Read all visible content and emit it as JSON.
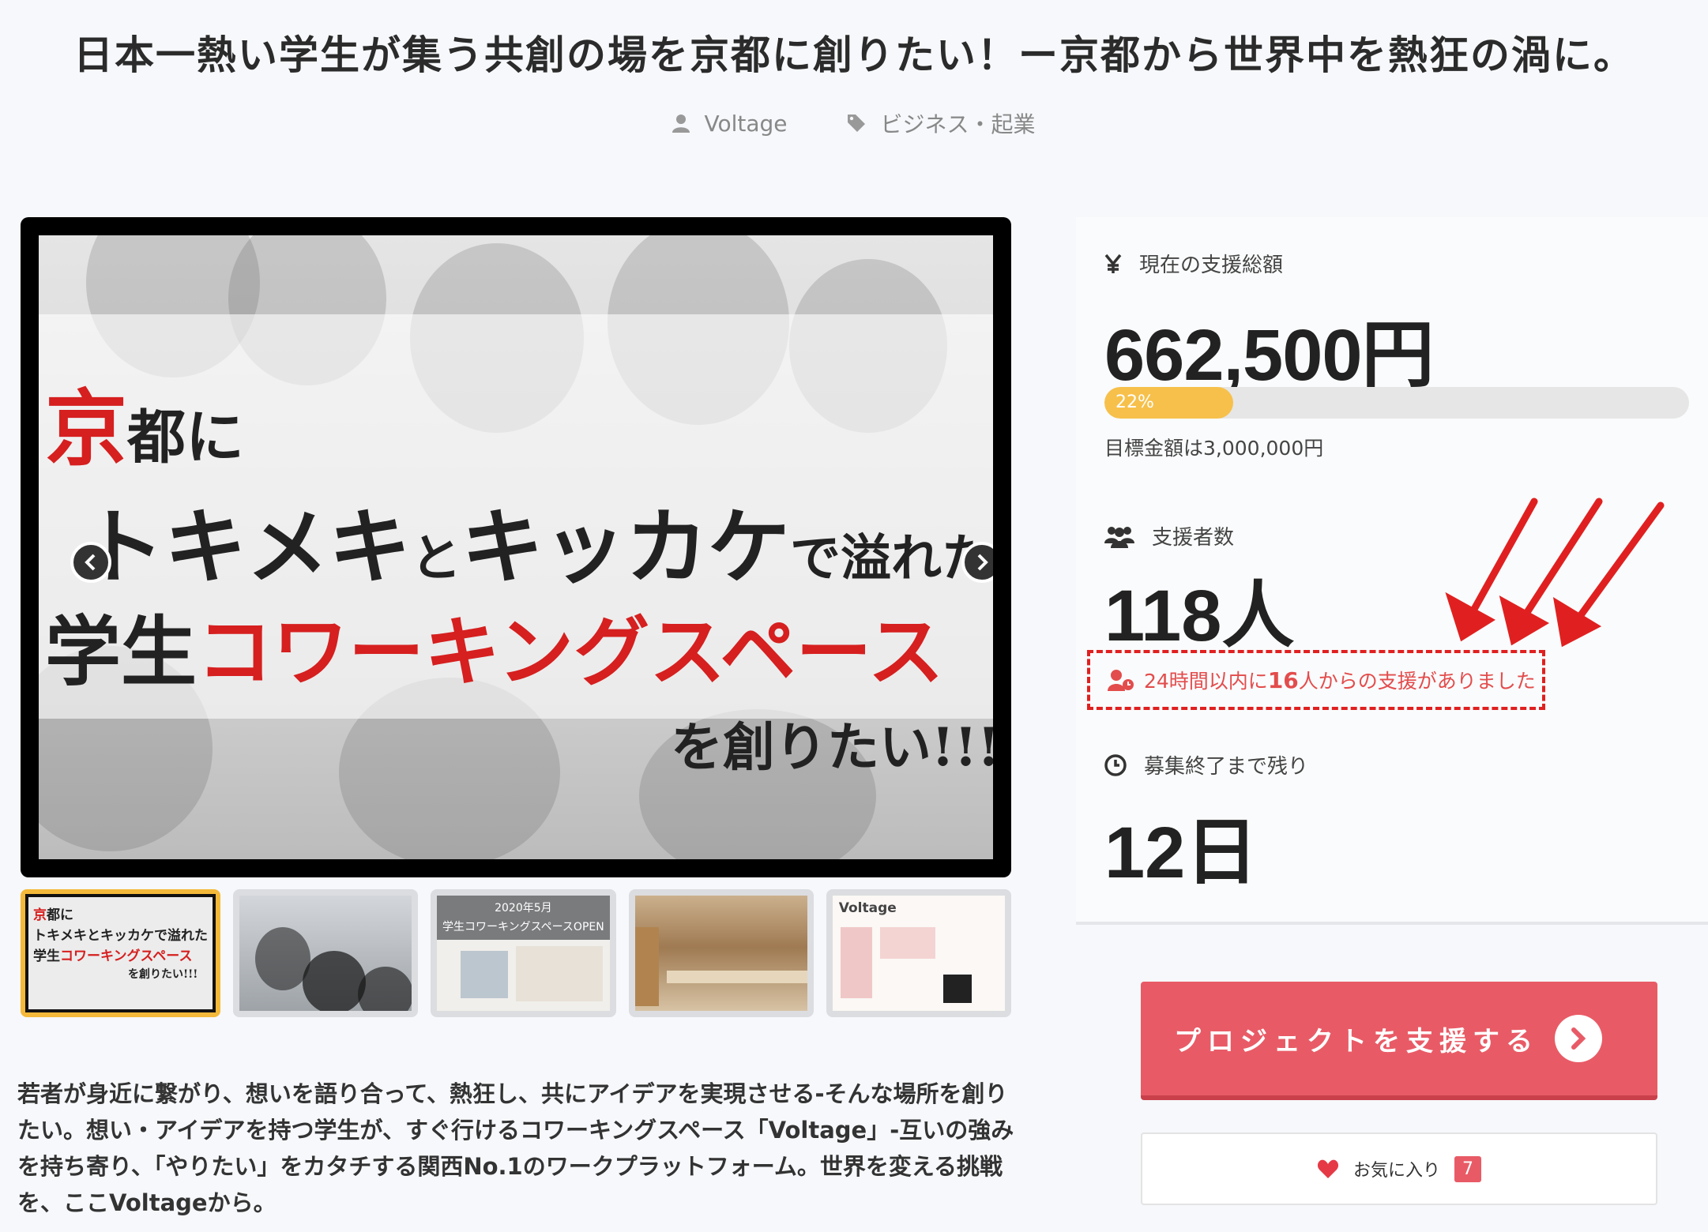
{
  "header": {
    "title": "日本一熱い学生が集う共創の場を京都に創りたい！ー京都から世界中を熱狂の渦に。",
    "owner": "Voltage",
    "category": "ビジネス・起業"
  },
  "slide": {
    "line1_red": "京",
    "line1_rest": "都に",
    "line2_a": "トキメキ",
    "line2_b": "と",
    "line2_c": "キッカケ",
    "line2_d": "で溢れた",
    "line3_a": "学生",
    "line3_b": "コワーキングスペース",
    "line4": "を創りたい!!!"
  },
  "thumbnails": {
    "t1_line1_red": "京",
    "t1_line1_rest": "都に",
    "t1_line2": "トキメキとキッカケで溢れた",
    "t1_line3_a": "学生",
    "t1_line3_b": "コワーキングスペース",
    "t1_line4": "を創りたい!!!",
    "t3_title": "2020年5月",
    "t3_sub": "学生コワーキングスペースOPEN",
    "t5_logo": "Voltage"
  },
  "stats": {
    "raised_label": "現在の支援総額",
    "raised_value": "662,500円",
    "progress_percent": 22,
    "progress_label": "22%",
    "goal_text": "目標金額は3,000,000円",
    "backers_label": "支援者数",
    "backers_value": "118人",
    "recent_prefix": "24時間以内に",
    "recent_count": "16",
    "recent_suffix": "人からの支援がありました",
    "remaining_label": "募集終了まで残り",
    "remaining_value": "12日"
  },
  "actions": {
    "support_label": "プロジェクトを支援する",
    "favorite_label": "お気に入り",
    "favorite_count": "7"
  },
  "description": "若者が身近に繋がり、想いを語り合って、熱狂し、共にアイデアを実現させる-そんな場所を創りたい。想い・アイデアを持つ学生が、すぐ行けるコワーキングスペース「Voltage」-互いの強みを持ち寄り、「やりたい」をカタチする関西No.1のワークプラットフォーム。世界を変える挑戦を、ここVoltageから。",
  "colors": {
    "accent_red": "#e85b66",
    "progress_yellow": "#f7c04a",
    "annotation_red": "#e02020"
  }
}
